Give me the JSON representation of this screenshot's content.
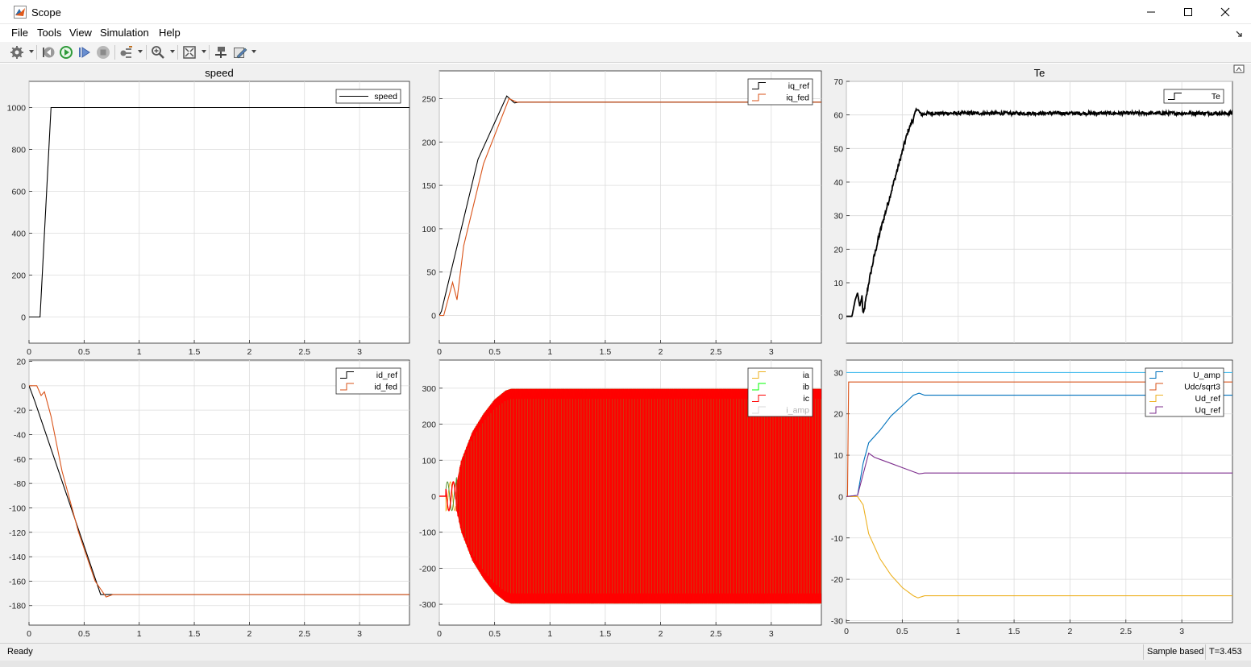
{
  "window": {
    "title": "Scope",
    "minimize_icon": "minimize-icon",
    "maximize_icon": "maximize-icon",
    "close_icon": "close-icon"
  },
  "menu": [
    {
      "name": "menu-file",
      "label": "File"
    },
    {
      "name": "menu-tools",
      "label": "Tools"
    },
    {
      "name": "menu-view",
      "label": "View"
    },
    {
      "name": "menu-simulation",
      "label": "Simulation"
    },
    {
      "name": "menu-help",
      "label": "Help"
    }
  ],
  "toolbar_icons": [
    "settings-gear-icon",
    "step-back-icon",
    "run-icon",
    "step-forward-icon",
    "stop-icon",
    "signal-selector-icon",
    "zoom-in-icon",
    "fit-to-view-icon",
    "highlight-block-icon",
    "measurement-pencil-icon"
  ],
  "status": {
    "ready": "Ready",
    "mode": "Sample based",
    "time": "T=3.453"
  },
  "colors": {
    "black": "#000000",
    "orange": "#d95319",
    "yellow": "#edb120",
    "green": "#00ff00",
    "red": "#ff0000",
    "light_gray": "#d9d9d9",
    "blue": "#0072bd",
    "purple": "#7e2f8e",
    "cyan": "#4dbeee"
  },
  "chart_data": [
    {
      "type": "line",
      "title": "speed",
      "xlim": [
        0,
        3.453
      ],
      "ylim": [
        -125,
        1125
      ],
      "xticks": [
        "0",
        "0.5",
        "1",
        "1.5",
        "2",
        "2.5",
        "3"
      ],
      "xtick_values": [
        0,
        0.5,
        1,
        1.5,
        2,
        2.5,
        3
      ],
      "yticks": [
        "0",
        "200",
        "400",
        "600",
        "800",
        "1000"
      ],
      "ytick_values": [
        0,
        200,
        400,
        600,
        800,
        1000
      ],
      "legend": "top-right",
      "series": [
        {
          "name": "speed",
          "color": "#000000",
          "x": [
            0,
            0.1,
            0.2,
            3.453
          ],
          "y": [
            0,
            0,
            1000,
            1000
          ]
        }
      ]
    },
    {
      "type": "line",
      "title": "",
      "xlim": [
        0,
        3.453
      ],
      "ylim": [
        -32,
        282
      ],
      "xticks": [
        "0",
        "0.5",
        "1",
        "1.5",
        "2",
        "2.5",
        "3"
      ],
      "xtick_values": [
        0,
        0.5,
        1,
        1.5,
        2,
        2.5,
        3
      ],
      "yticks": [
        "0",
        "50",
        "100",
        "150",
        "200",
        "250"
      ],
      "ytick_values": [
        0,
        50,
        100,
        150,
        200,
        250
      ],
      "legend": "top-right",
      "series": [
        {
          "name": "iq_ref",
          "color": "#000000",
          "x": [
            0,
            0.02,
            0.35,
            0.61,
            0.68,
            0.72,
            3.453
          ],
          "y": [
            0,
            5,
            180,
            253,
            245,
            246,
            246
          ]
        },
        {
          "name": "iq_fed",
          "color": "#d95319",
          "x": [
            0,
            0.04,
            0.12,
            0.16,
            0.22,
            0.4,
            0.63,
            0.7,
            3.453
          ],
          "y": [
            0,
            0,
            38,
            18,
            80,
            175,
            250,
            246,
            246
          ]
        }
      ]
    },
    {
      "type": "line",
      "title": "Te",
      "xlim": [
        0,
        3.453
      ],
      "ylim": [
        -8,
        70
      ],
      "xticks": [],
      "xtick_values": [],
      "yticks": [
        "0",
        "10",
        "20",
        "30",
        "40",
        "50",
        "60",
        "70"
      ],
      "ytick_values": [
        0,
        10,
        20,
        30,
        40,
        50,
        60,
        70
      ],
      "legend": "top-right",
      "series": [
        {
          "name": "Te",
          "color": "#000000",
          "noise": 0.5,
          "x": [
            0,
            0.05,
            0.08,
            0.1,
            0.12,
            0.14,
            0.15,
            0.2,
            0.25,
            0.3,
            0.35,
            0.4,
            0.45,
            0.5,
            0.55,
            0.6,
            0.63,
            0.67,
            0.72,
            3.453
          ],
          "y": [
            0,
            0,
            5,
            7,
            3,
            6,
            0,
            10,
            18,
            25,
            31,
            37,
            43,
            49,
            55,
            59,
            62,
            60,
            60.5,
            60.5
          ]
        }
      ]
    },
    {
      "type": "line",
      "title": "",
      "xlim": [
        0,
        3.453
      ],
      "ylim": [
        -196,
        21
      ],
      "xticks": [
        "0",
        "0.5",
        "1",
        "1.5",
        "2",
        "2.5",
        "3"
      ],
      "xtick_values": [
        0,
        0.5,
        1,
        1.5,
        2,
        2.5,
        3
      ],
      "yticks": [
        "20",
        "0",
        "-20",
        "-40",
        "-60",
        "-80",
        "-100",
        "-120",
        "-140",
        "-160",
        "-180"
      ],
      "ytick_values": [
        20,
        0,
        -20,
        -40,
        -60,
        -80,
        -100,
        -120,
        -140,
        -160,
        -180
      ],
      "legend": "top-right",
      "series": [
        {
          "name": "id_ref",
          "color": "#000000",
          "x": [
            0,
            0.05,
            0.65,
            0.72,
            3.453
          ],
          "y": [
            0,
            -12,
            -171,
            -171,
            -171
          ]
        },
        {
          "name": "id_fed",
          "color": "#d95319",
          "x": [
            0,
            0.07,
            0.11,
            0.14,
            0.2,
            0.3,
            0.45,
            0.6,
            0.7,
            0.76,
            3.453
          ],
          "y": [
            0,
            0,
            -8,
            -5,
            -25,
            -70,
            -120,
            -160,
            -173,
            -171,
            -171
          ]
        }
      ]
    },
    {
      "type": "line",
      "title": "",
      "xlim": [
        0,
        3.453
      ],
      "ylim": [
        -358,
        378
      ],
      "xticks": [
        "0",
        "0.5",
        "1",
        "1.5",
        "2",
        "2.5",
        "3"
      ],
      "xtick_values": [
        0,
        0.5,
        1,
        1.5,
        2,
        2.5,
        3
      ],
      "yticks": [
        "300",
        "200",
        "100",
        "0",
        "-100",
        "-200",
        "-300"
      ],
      "ytick_values": [
        300,
        200,
        100,
        0,
        -100,
        -200,
        -300
      ],
      "legend": "top-right",
      "envelope": {
        "x": [
          0.15,
          0.2,
          0.3,
          0.4,
          0.5,
          0.6,
          0.65,
          3.453
        ],
        "amp": [
          30,
          100,
          180,
          230,
          270,
          295,
          300,
          300
        ]
      },
      "series": [
        {
          "name": "ia",
          "color": "#edb120"
        },
        {
          "name": "ib",
          "color": "#00ff00"
        },
        {
          "name": "ic",
          "color": "#ff0000"
        },
        {
          "name": "i_amp",
          "color": "#d9d9d9"
        }
      ]
    },
    {
      "type": "line",
      "title": "",
      "xlim": [
        0,
        3.453
      ],
      "ylim": [
        -30.5,
        33
      ],
      "xticks": [
        "0",
        "0.5",
        "1",
        "1.5",
        "2",
        "2.5",
        "3"
      ],
      "xtick_values": [
        0,
        0.5,
        1,
        1.5,
        2,
        2.5,
        3
      ],
      "yticks": [
        "30",
        "20",
        "10",
        "0",
        "-10",
        "-20",
        "-30"
      ],
      "ytick_values": [
        30,
        20,
        10,
        0,
        -10,
        -20,
        -30
      ],
      "legend": "top-right",
      "series": [
        {
          "name": "U_amp",
          "color": "#0072bd",
          "x": [
            0,
            0.1,
            0.15,
            0.2,
            0.3,
            0.4,
            0.5,
            0.6,
            0.65,
            0.7,
            3.453
          ],
          "y": [
            0,
            0.3,
            8,
            13,
            16,
            19.5,
            22,
            24.5,
            25,
            24.5,
            24.5
          ]
        },
        {
          "name": "Udc/sqrt3",
          "color": "#d95319",
          "x": [
            0,
            0.01,
            0.02,
            3.453
          ],
          "y": [
            0,
            0,
            27.7,
            27.7
          ]
        },
        {
          "name": "Ud_ref",
          "color": "#edb120",
          "x": [
            0,
            0.1,
            0.15,
            0.2,
            0.3,
            0.4,
            0.5,
            0.6,
            0.64,
            0.7,
            3.453
          ],
          "y": [
            0,
            0,
            -2,
            -9,
            -15,
            -19,
            -22,
            -24,
            -24.5,
            -24,
            -24
          ]
        },
        {
          "name": "Uq_ref",
          "color": "#7e2f8e",
          "x": [
            0,
            0.1,
            0.2,
            0.25,
            0.3,
            0.4,
            0.5,
            0.6,
            0.65,
            0.7,
            3.453
          ],
          "y": [
            0,
            0.3,
            10.5,
            9.5,
            9,
            8,
            7,
            6,
            5.5,
            5.7,
            5.7
          ]
        },
        {
          "name": "",
          "color": "#4dbeee",
          "x": [
            0,
            3.453
          ],
          "y": [
            30,
            30
          ]
        }
      ]
    }
  ]
}
